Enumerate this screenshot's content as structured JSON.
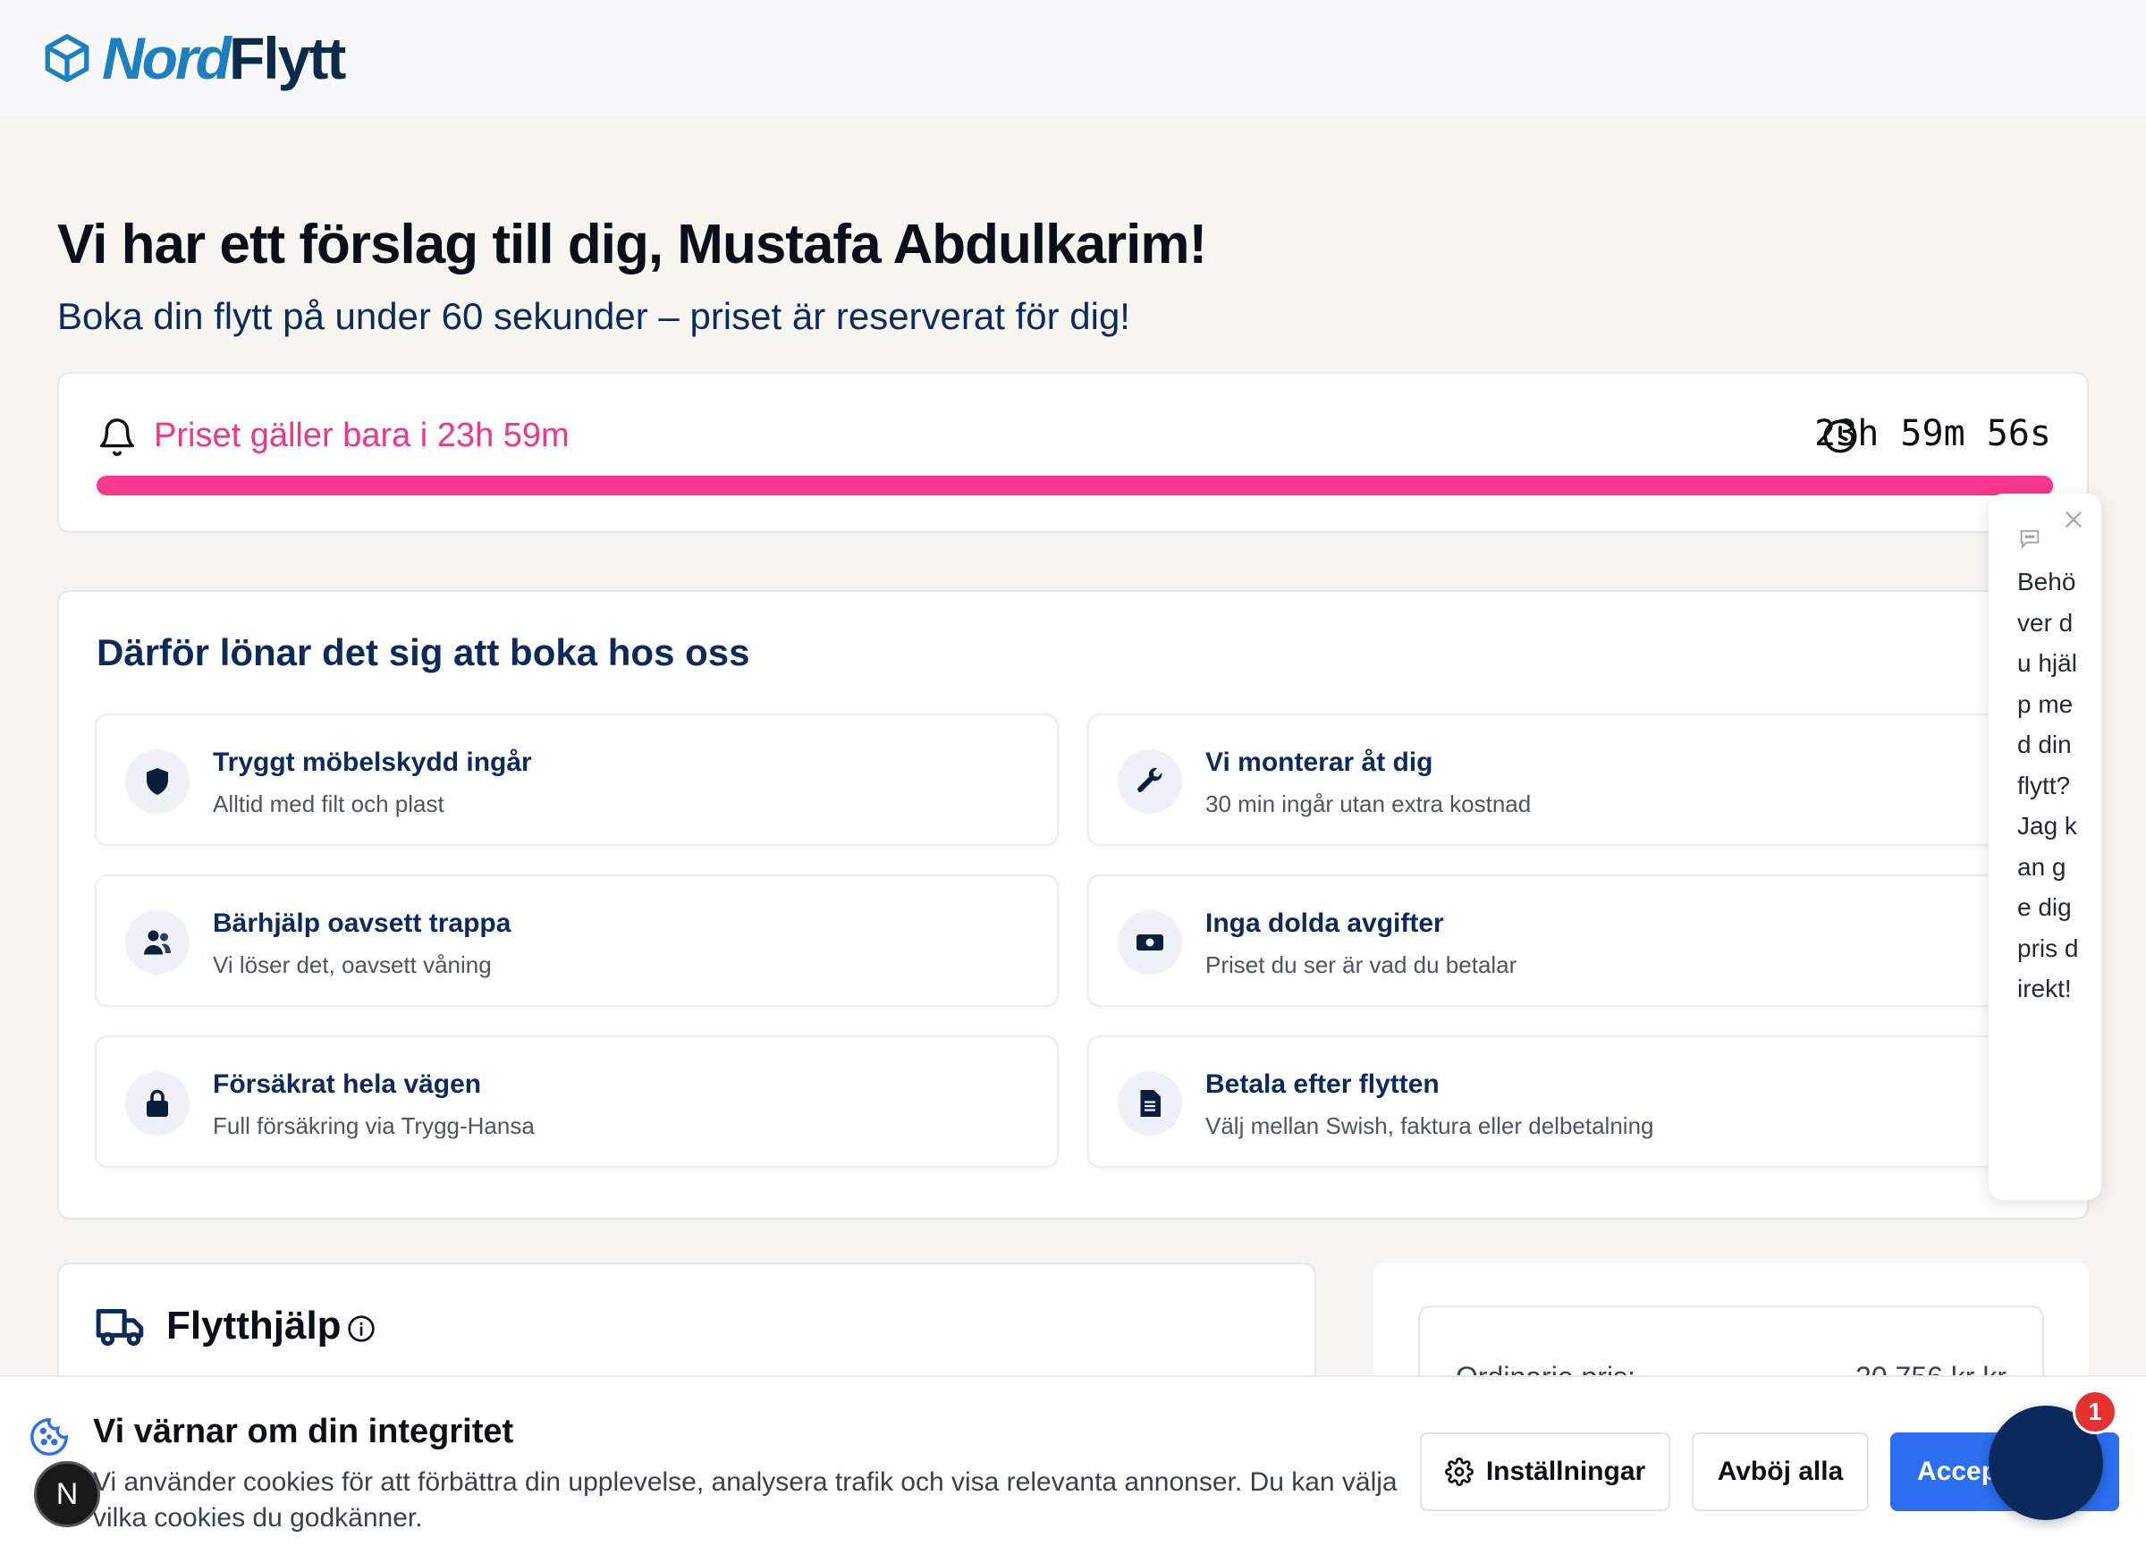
{
  "brand": {
    "part1": "Nord",
    "part2": "Flytt",
    "logo_icon": "box-icon"
  },
  "hero": {
    "title": "Vi har ett förslag till dig, Mustafa Abdulkarim!",
    "subtitle": "Boka din flytt på under 60 sekunder – priset är reserverat för dig!"
  },
  "timer": {
    "label": "Priset gäller bara i 23h 59m",
    "countdown": "23h 59m 56s",
    "progress_percent": 99.9,
    "accent_color": "#f8378e"
  },
  "benefits": {
    "title": "Därför lönar det sig att boka hos oss",
    "items": [
      {
        "title": "Tryggt möbelskydd ingår",
        "desc": "Alltid med filt och plast",
        "icon": "shield-icon"
      },
      {
        "title": "Vi monterar åt dig",
        "desc": "30 min ingår utan extra kostnad",
        "icon": "wrench-icon"
      },
      {
        "title": "Bärhjälp oavsett trappa",
        "desc": "Vi löser det, oavsett våning",
        "icon": "users-icon"
      },
      {
        "title": "Inga dolda avgifter",
        "desc": "Priset du ser är vad du betalar",
        "icon": "money-icon"
      },
      {
        "title": "Försäkrat hela vägen",
        "desc": "Full försäkring via Trygg-Hansa",
        "icon": "lock-icon"
      },
      {
        "title": "Betala efter flytten",
        "desc": "Välj mellan Swish, faktura eller delbetalning",
        "icon": "document-icon"
      }
    ]
  },
  "move": {
    "title": "Flytthjälp"
  },
  "price": {
    "label": "Ordinarie pris:",
    "value": "20 756 kr kr"
  },
  "chat": {
    "message": "Behöver du hjälp med din flytt? Jag kan ge dig pris direkt!",
    "fab_badge": "1"
  },
  "cookie": {
    "title": "Vi värnar om din integritet",
    "text": "Vi använder cookies för att förbättra din upplevelse, analysera trafik och visa relevanta annonser. Du kan välja vilka cookies du godkänner.",
    "settings_label": "Inställningar",
    "reject_label": "Avböj alla",
    "accept_label": "Acceptera alla"
  },
  "dev_badge": "N"
}
